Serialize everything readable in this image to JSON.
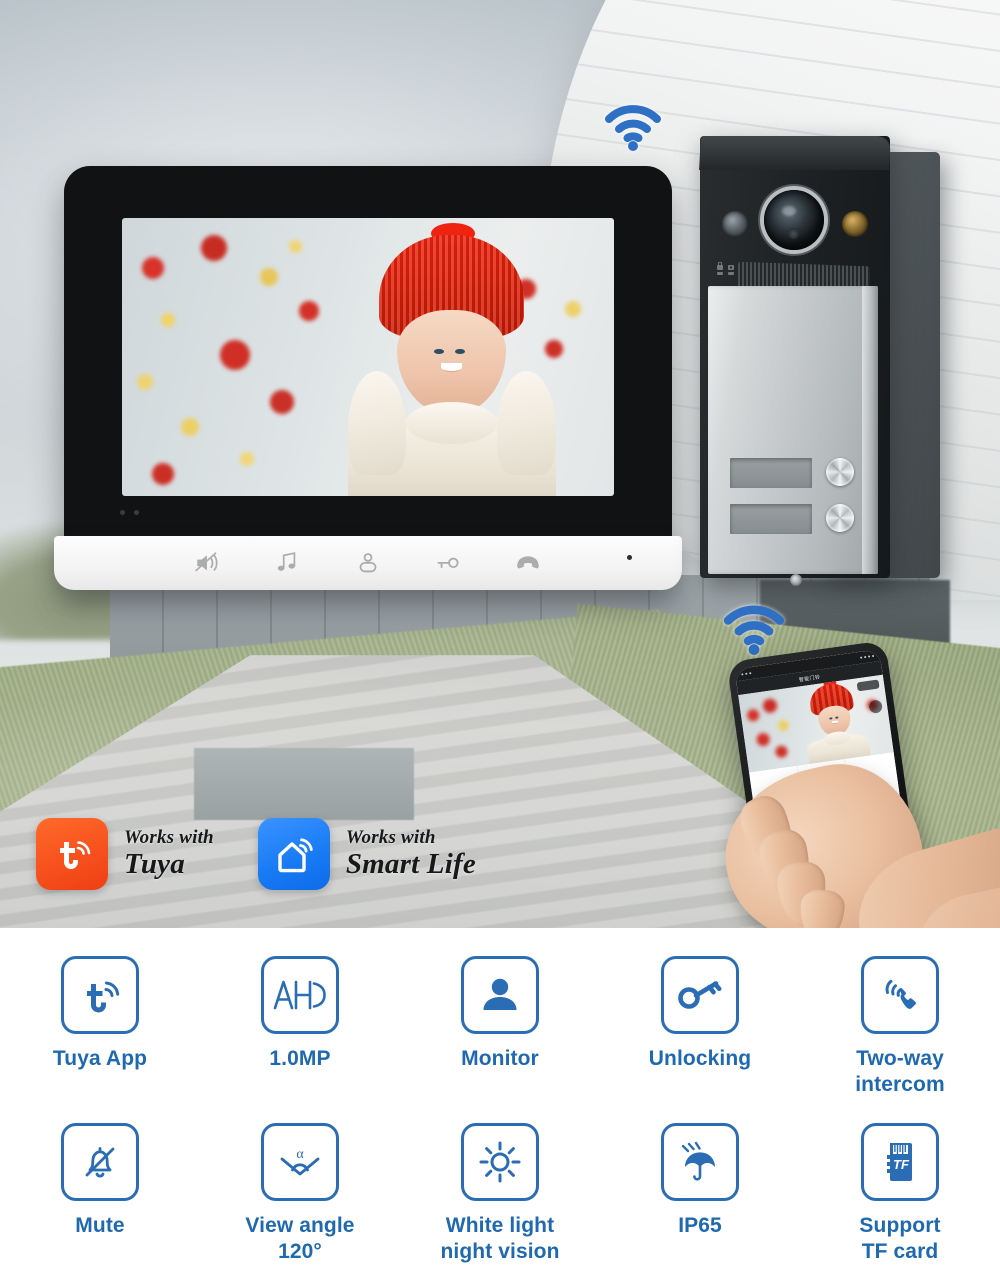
{
  "hero": {
    "monitor": {
      "name": "indoor-monitor",
      "screen_content": "woman in red knit hat smiling in front of christmas tree",
      "buttons": [
        {
          "name": "mute-button",
          "icon": "mute-icon"
        },
        {
          "name": "ringtone-button",
          "icon": "music-note-icon"
        },
        {
          "name": "monitor-button",
          "icon": "monitor-icon"
        },
        {
          "name": "unlock-button",
          "icon": "key-icon"
        },
        {
          "name": "talk-button",
          "icon": "phone-handset-icon"
        }
      ]
    },
    "doorbell": {
      "name": "outdoor-doorbell-station",
      "call_buttons": [
        "call-button-1",
        "call-button-2"
      ],
      "nameplates": [
        "nameplate-slot-1",
        "nameplate-slot-2"
      ]
    },
    "wifi_indicators": [
      "wifi-signal-monitor",
      "wifi-signal-phone"
    ],
    "phone": {
      "app_title": "智能门铃",
      "controls": [
        "snapshot-icon",
        "mute-icon",
        "record-icon",
        "unlock-icon",
        "refresh-icon",
        "gallery-icon"
      ]
    },
    "badges": [
      {
        "id": "tuya",
        "icon": "tuya-logo-icon",
        "line1": "Works with",
        "line2": "Tuya",
        "color": "#f7511e"
      },
      {
        "id": "smart-life",
        "icon": "smart-home-wifi-icon",
        "line1": "Works with",
        "line2": "Smart Life",
        "color": "#1a7cf5"
      }
    ]
  },
  "features": {
    "accent_color": "#1f69b0",
    "border_color": "#2a6db5",
    "row1": [
      {
        "icon": "tuya-app-icon",
        "label": "Tuya App"
      },
      {
        "icon": "ahd-icon",
        "label": "1.0MP"
      },
      {
        "icon": "person-monitor-icon",
        "label": "Monitor"
      },
      {
        "icon": "key-unlock-icon",
        "label": "Unlocking"
      },
      {
        "icon": "phone-waves-icon",
        "label": "Two-way\nintercom"
      }
    ],
    "row2": [
      {
        "icon": "bell-muted-icon",
        "label": "Mute"
      },
      {
        "icon": "view-angle-icon",
        "label": "View angle\n120°"
      },
      {
        "icon": "sun-icon",
        "label": "White light\nnight vision"
      },
      {
        "icon": "umbrella-rain-icon",
        "label": "IP65"
      },
      {
        "icon": "tf-card-icon",
        "label": "Support\nTF card"
      }
    ]
  }
}
